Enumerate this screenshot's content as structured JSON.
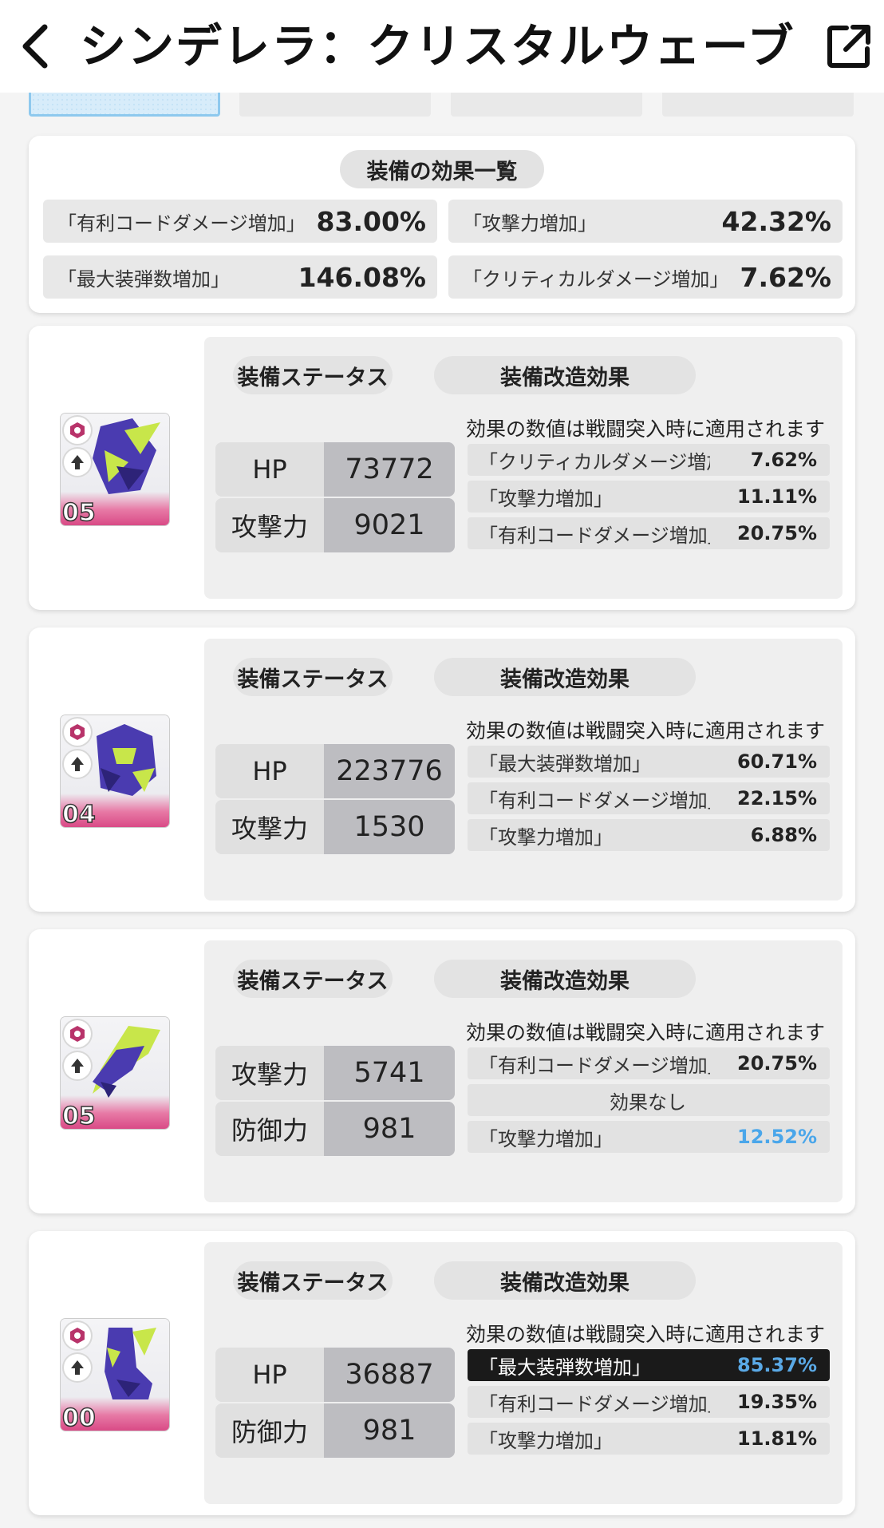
{
  "header": {
    "title": "シンデレラ：クリスタルウェーブ",
    "back_icon": "chevron-left-icon",
    "share_icon": "external-link-icon"
  },
  "summary": {
    "title": "装備の効果一覧",
    "items": [
      {
        "label": "「有利コードダメージ増加」",
        "value": "83.00%"
      },
      {
        "label": "「攻撃力増加」",
        "value": "42.32%"
      },
      {
        "label": "「最大装弾数増加」",
        "value": "146.08%"
      },
      {
        "label": "「クリティカルダメージ増加」",
        "value": "7.62%"
      }
    ]
  },
  "common": {
    "status_title": "装備ステータス",
    "mod_title": "装備改造効果",
    "note": "効果の数値は戦闘突入時に適用されます"
  },
  "equipment": [
    {
      "level": "05",
      "stats": [
        {
          "label": "HP",
          "value": "73772"
        },
        {
          "label": "攻撃力",
          "value": "9021"
        }
      ],
      "effects": [
        {
          "label": "「クリティカルダメージ増加」",
          "value": "7.62%"
        },
        {
          "label": "「攻撃力増加」",
          "value": "11.11%"
        },
        {
          "label": "「有利コードダメージ増加」",
          "value": "20.75%"
        }
      ]
    },
    {
      "level": "04",
      "stats": [
        {
          "label": "HP",
          "value": "223776"
        },
        {
          "label": "攻撃力",
          "value": "1530"
        }
      ],
      "effects": [
        {
          "label": "「最大装弾数増加」",
          "value": "60.71%"
        },
        {
          "label": "「有利コードダメージ増加」",
          "value": "22.15%"
        },
        {
          "label": "「攻撃力増加」",
          "value": "6.88%"
        }
      ]
    },
    {
      "level": "05",
      "stats": [
        {
          "label": "攻撃力",
          "value": "5741"
        },
        {
          "label": "防御力",
          "value": "981"
        }
      ],
      "effects": [
        {
          "label": "「有利コードダメージ増加」",
          "value": "20.75%"
        },
        {
          "label": "効果なし",
          "value": ""
        },
        {
          "label": "「攻撃力増加」",
          "value": "12.52%"
        }
      ]
    },
    {
      "level": "00",
      "stats": [
        {
          "label": "HP",
          "value": "36887"
        },
        {
          "label": "防御力",
          "value": "981"
        }
      ],
      "effects": [
        {
          "label": "「最大装弾数増加」",
          "value": "85.37%"
        },
        {
          "label": "「有利コードダメージ増加」",
          "value": "19.35%"
        },
        {
          "label": "「攻撃力増加」",
          "value": "11.81%"
        }
      ]
    }
  ],
  "colors": {
    "highlight_blue": "#4aa6ea",
    "rarity_pink": "#d94a86",
    "art_purple": "#4a3bb0",
    "art_lime": "#c8e64a"
  }
}
